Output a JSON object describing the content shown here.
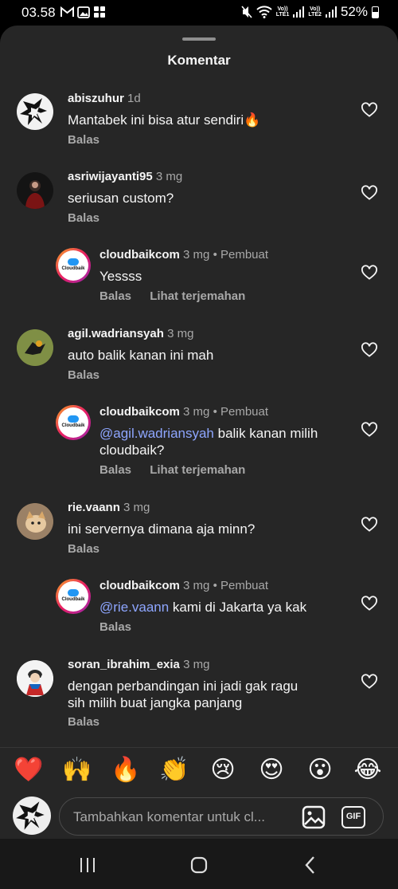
{
  "status_bar": {
    "time": "03.58",
    "battery": "52%",
    "battery_level": 0.52,
    "sim1_label_top": "Vo))",
    "sim1_label_bottom": "LTE1",
    "sim2_label_top": "Vo))",
    "sim2_label_bottom": "LTE2",
    "left_icons": [
      "gmail-icon",
      "gallery-icon",
      "app-grid-icon"
    ],
    "right_icons": [
      "mute-icon",
      "wifi-icon",
      "signal-icon",
      "signal-icon",
      "battery-icon"
    ]
  },
  "sheet": {
    "title": "Komentar"
  },
  "comments": [
    {
      "username": "abiszuhur",
      "time": "1d",
      "text": "Mantabek ini bisa atur sendiri🔥",
      "reply_label": "Balas"
    },
    {
      "username": "asriwijayanti95",
      "time": "3 mg",
      "text": "seriusan custom?",
      "reply_label": "Balas"
    },
    {
      "username": "cloudbaikcom",
      "time": "3 mg",
      "separator": "•",
      "author_label": "Pembuat",
      "text": "Yessss",
      "reply_label": "Balas",
      "translate_label": "Lihat terjemahan"
    },
    {
      "username": "agil.wadriansyah",
      "time": "3 mg",
      "text": "auto balik kanan ini mah",
      "reply_label": "Balas"
    },
    {
      "username": "cloudbaikcom",
      "time": "3 mg",
      "separator": "•",
      "author_label": "Pembuat",
      "mention": "@agil.wadriansyah",
      "text_line1": " balik kanan milih",
      "text_line2": "cloudbaik?",
      "reply_label": "Balas",
      "translate_label": "Lihat terjemahan"
    },
    {
      "username": "rie.vaann",
      "time": "3 mg",
      "text": "ini servernya dimana aja minn?",
      "reply_label": "Balas"
    },
    {
      "username": "cloudbaikcom",
      "time": "3 mg",
      "separator": "•",
      "author_label": "Pembuat",
      "mention": "@rie.vaann",
      "text": " kami di Jakarta ya kak",
      "reply_label": "Balas"
    },
    {
      "username": "soran_ibrahim_exia",
      "time": "3 mg",
      "text_line1": "dengan perbandingan ini jadi gak ragu",
      "text_line2": "sih milih buat jangka panjang",
      "reply_label": "Balas"
    }
  ],
  "brand": {
    "logo_text": "Cloudbaik",
    "accent": "#2196f3"
  },
  "emoji_bar": [
    "❤️",
    "🙌",
    "🔥",
    "👏",
    "😢",
    "😍",
    "😮",
    "😂"
  ],
  "input": {
    "placeholder": "Tambahkan komentar untuk cl...",
    "gif_label": "GIF"
  },
  "colors": {
    "background": "#262626",
    "text": "#f5f5f5",
    "secondary": "#a8a8a8",
    "mention": "#8ea6ff"
  },
  "nav": [
    "recent-apps-icon",
    "home-icon",
    "back-icon"
  ]
}
